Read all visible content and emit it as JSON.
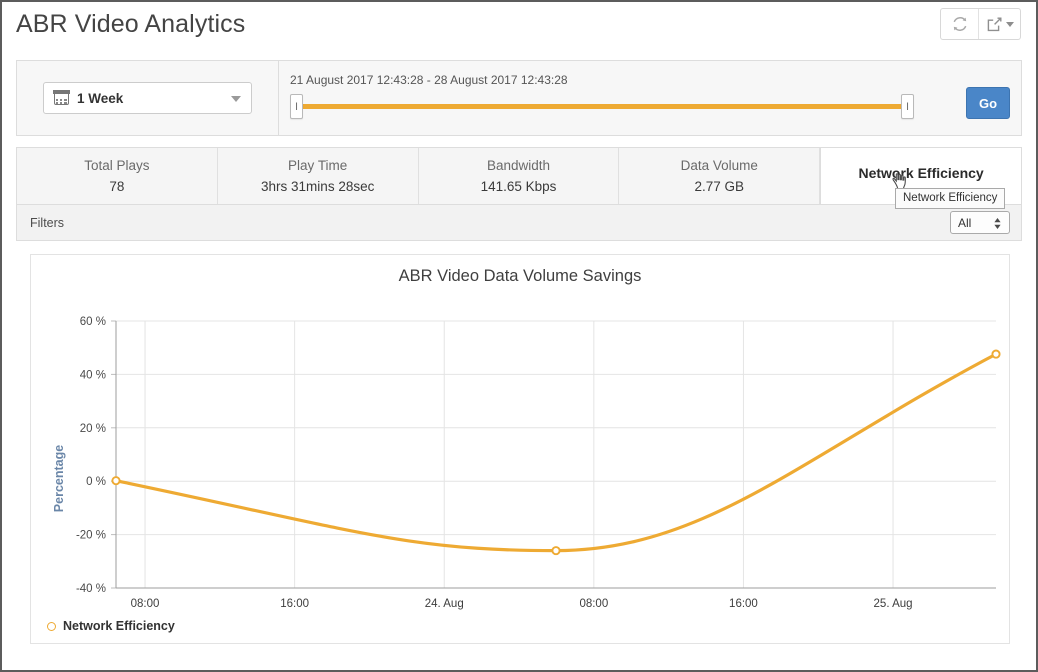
{
  "header": {
    "title": "ABR Video Analytics",
    "refresh_icon": "refresh-icon",
    "export_icon": "export-icon"
  },
  "time_selector": {
    "period_label": "1 Week",
    "calendar_icon": "calendar-icon",
    "range_text": "21 August 2017 12:43:28 - 28 August 2017 12:43:28",
    "handle_glyph": "I",
    "go_label": "Go"
  },
  "kpis": [
    {
      "label": "Total Plays",
      "value": "78",
      "active": false
    },
    {
      "label": "Play Time",
      "value": "3hrs 31mins 28sec",
      "active": false
    },
    {
      "label": "Bandwidth",
      "value": "141.65 Kbps",
      "active": false
    },
    {
      "label": "Data Volume",
      "value": "2.77 GB",
      "active": false
    },
    {
      "label": "Network Efficiency",
      "value": "",
      "active": true
    }
  ],
  "tooltip": {
    "text": "Network Efficiency"
  },
  "filters": {
    "label": "Filters",
    "selected": "All",
    "options": [
      "All"
    ]
  },
  "colors": {
    "accent_orange": "#eeaa33",
    "go_blue": "#4a86c8",
    "axis_label_blue": "#6a86a8",
    "grid": "#e4e4e4"
  },
  "chart_data": {
    "type": "line",
    "title": "ABR Video Data Volume Savings",
    "xlabel": "",
    "ylabel": "Percentage",
    "ylim": [
      -40,
      60
    ],
    "ytick_values": [
      60,
      40,
      20,
      0,
      -20,
      -40
    ],
    "ytick_labels": [
      "60 %",
      "40 %",
      "20 %",
      "0 %",
      "-20 %",
      "-40 %"
    ],
    "xtick_labels": [
      "08:00",
      "16:00",
      "24. Aug",
      "08:00",
      "16:00",
      "25. Aug"
    ],
    "xtick_positions": [
      0.033,
      0.203,
      0.373,
      0.543,
      0.713,
      0.883
    ],
    "grid": true,
    "legend_position": "bottom-left",
    "series": [
      {
        "name": "Network Efficiency",
        "marker": "open-circle",
        "color": "#eeaa33",
        "points": [
          {
            "x": 0.0,
            "y": 0.2
          },
          {
            "x": 0.5,
            "y": -26.0
          },
          {
            "x": 1.0,
            "y": 47.6
          }
        ]
      }
    ]
  }
}
